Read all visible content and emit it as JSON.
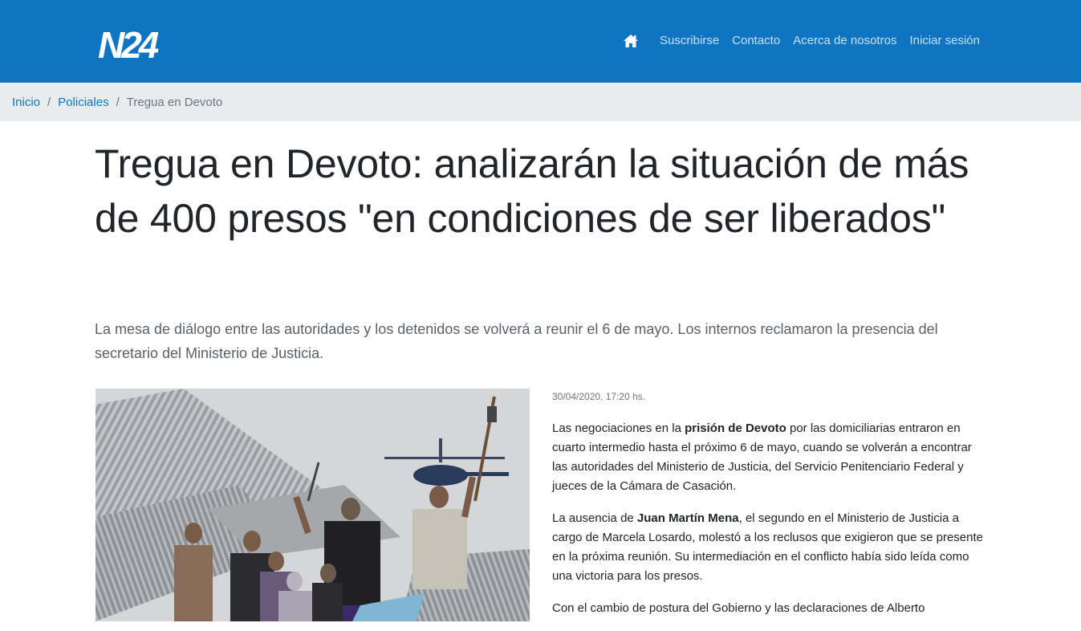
{
  "header": {
    "logo_text": "N24",
    "nav": {
      "home_icon": "home-icon",
      "items": [
        "Suscribirse",
        "Contacto",
        "Acerca de nosotros",
        "Iniciar sesión"
      ]
    },
    "colors": {
      "bar": "#0f75c2",
      "nav_text": "#c7e0f4"
    }
  },
  "breadcrumb": {
    "items": [
      "Inicio",
      "Policiales"
    ],
    "separator": "/",
    "current": "Tregua en Devoto"
  },
  "article": {
    "title": "Tregua en Devoto: analizarán la situación de más de 400 presos \"en condiciones de ser liberados\"",
    "lead": "La mesa de diálogo entre las autoridades y los detenidos se volverá a reunir el 6 de mayo. Los internos reclamaron la presencia del secretario del Ministerio de Justicia.",
    "date": "30/04/2020, 17:20 hs.",
    "paragraphs": [
      {
        "before": "Las negociaciones en la ",
        "bold": "prisión de Devoto",
        "after": " por las domiciliarias entraron en cuarto intermedio hasta el próximo 6 de mayo, cuando se volverán a encontrar las autoridades del Ministerio de Justicia, del Servicio Penitenciario Federal y jueces de la Cámara de Casación."
      },
      {
        "before": "La ausencia de ",
        "bold": "Juan Martín Mena",
        "after": ", el segundo en el Ministerio de Justicia a cargo de Marcela Losardo, molestó a los reclusos que exigieron que se presente en la próxima reunión. Su intermediación en el conflicto había sido leída como una victoria para los presos."
      },
      {
        "before": "Con el cambio de postura del Gobierno y las declaraciones de Alberto",
        "bold": "",
        "after": ""
      }
    ]
  }
}
